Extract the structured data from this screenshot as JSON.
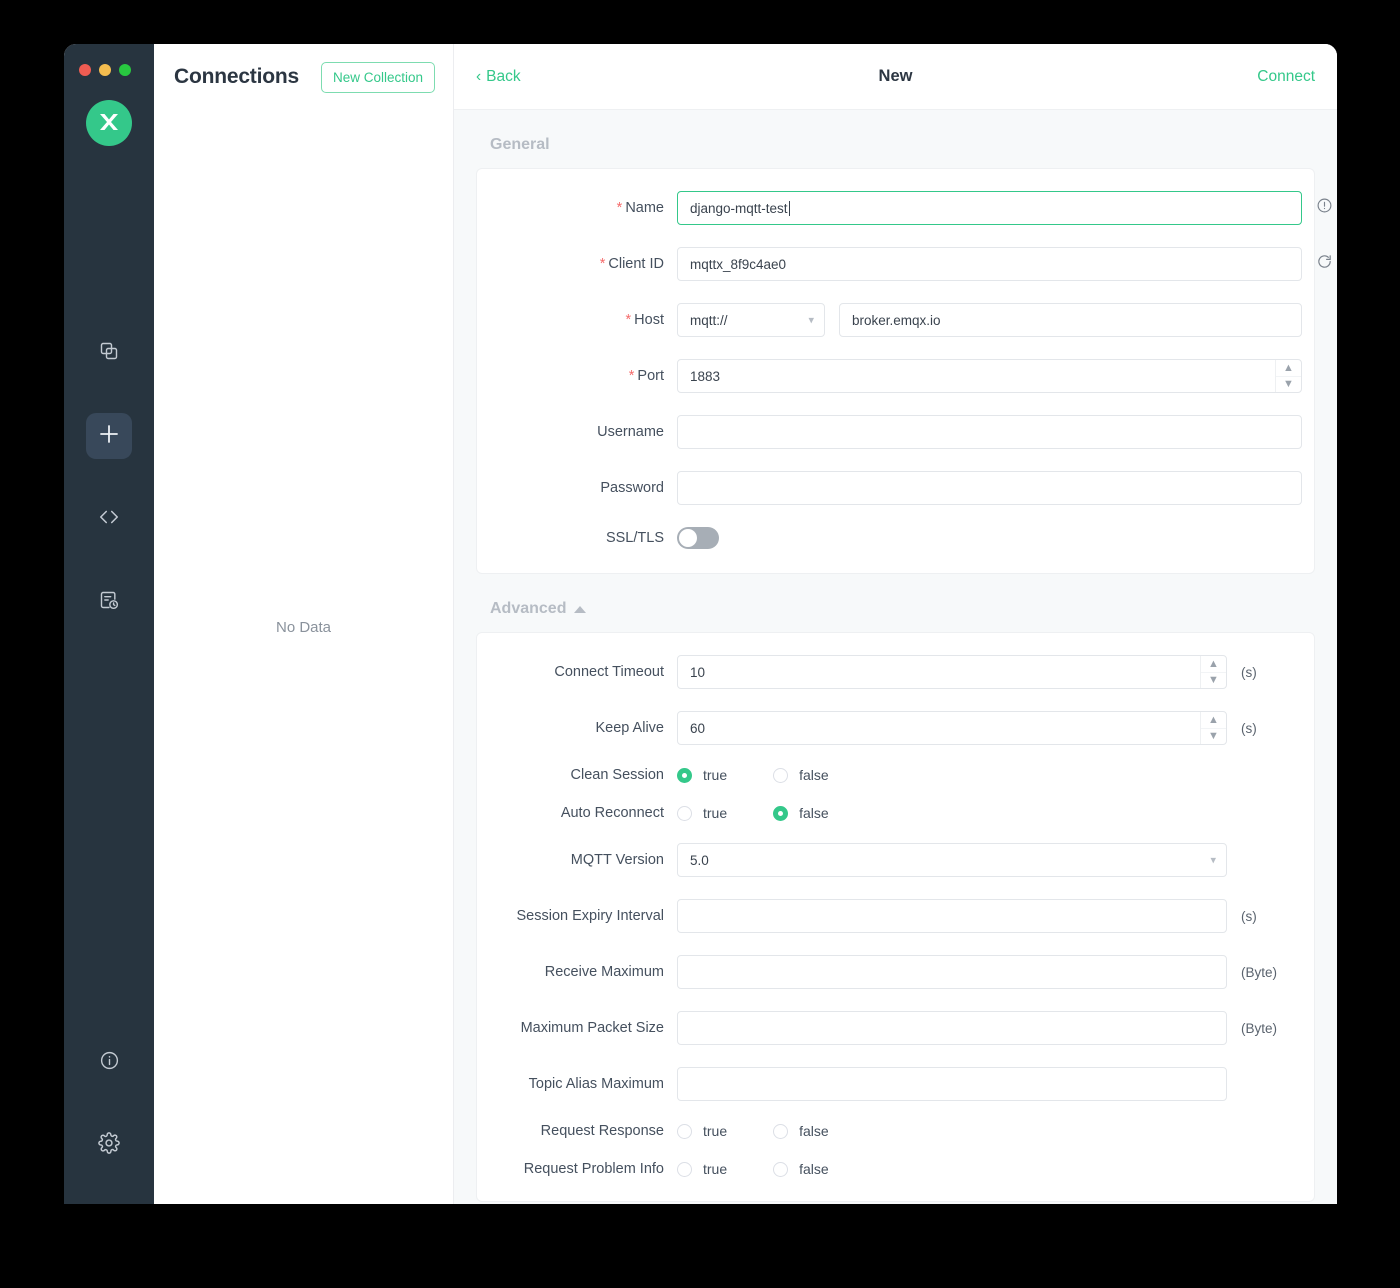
{
  "window": {
    "traffic_lights": [
      "close",
      "minimize",
      "maximize"
    ],
    "app_logo": "mqttx-logo-icon"
  },
  "rail": {
    "items": [
      {
        "name": "connections-icon",
        "active": false
      },
      {
        "name": "new-connection-icon",
        "active": true
      },
      {
        "name": "script-code-icon",
        "active": false
      },
      {
        "name": "log-history-icon",
        "active": false
      }
    ],
    "bottom_items": [
      {
        "name": "about-info-icon"
      },
      {
        "name": "settings-gear-icon"
      }
    ]
  },
  "connections": {
    "title": "Connections",
    "new_collection_label": "New Collection",
    "empty_text": "No Data"
  },
  "header": {
    "back_label": "Back",
    "title": "New",
    "connect_label": "Connect"
  },
  "general": {
    "section_title": "General",
    "name": {
      "label": "Name",
      "required": true,
      "value": "django-mqtt-test",
      "info_icon": "info-circle-icon"
    },
    "client_id": {
      "label": "Client ID",
      "required": true,
      "value": "mqttx_8f9c4ae0",
      "refresh_icon": "refresh-icon",
      "history_icon": "clock-icon"
    },
    "host": {
      "label": "Host",
      "required": true,
      "protocol": "mqtt://",
      "address": "broker.emqx.io"
    },
    "port": {
      "label": "Port",
      "required": true,
      "value": "1883"
    },
    "username": {
      "label": "Username",
      "value": "",
      "placeholder": ""
    },
    "password": {
      "label": "Password",
      "value": "",
      "placeholder": ""
    },
    "ssl_tls": {
      "label": "SSL/TLS",
      "enabled": false
    }
  },
  "advanced": {
    "section_title": "Advanced",
    "collapsed": false,
    "connect_timeout": {
      "label": "Connect Timeout",
      "value": "10",
      "unit": "(s)"
    },
    "keep_alive": {
      "label": "Keep Alive",
      "value": "60",
      "unit": "(s)"
    },
    "clean_session": {
      "label": "Clean Session",
      "true_label": "true",
      "false_label": "false",
      "value": "true"
    },
    "auto_reconnect": {
      "label": "Auto Reconnect",
      "true_label": "true",
      "false_label": "false",
      "value": "false"
    },
    "mqtt_version": {
      "label": "MQTT Version",
      "value": "5.0"
    },
    "session_expiry_interval": {
      "label": "Session Expiry Interval",
      "value": "",
      "unit": "(s)"
    },
    "receive_maximum": {
      "label": "Receive Maximum",
      "value": "",
      "unit": "(Byte)"
    },
    "maximum_packet_size": {
      "label": "Maximum Packet Size",
      "value": "",
      "unit": "(Byte)"
    },
    "topic_alias_maximum": {
      "label": "Topic Alias Maximum",
      "value": ""
    },
    "request_response": {
      "label": "Request Response",
      "true_label": "true",
      "false_label": "false",
      "value": ""
    },
    "request_problem_info": {
      "label": "Request Problem Info",
      "true_label": "true",
      "false_label": "false",
      "value": ""
    }
  },
  "colors": {
    "accent": "#34c88a",
    "rail_bg": "#27343f",
    "required": "#f56c6c",
    "page_bg": "#f7f9fa"
  }
}
